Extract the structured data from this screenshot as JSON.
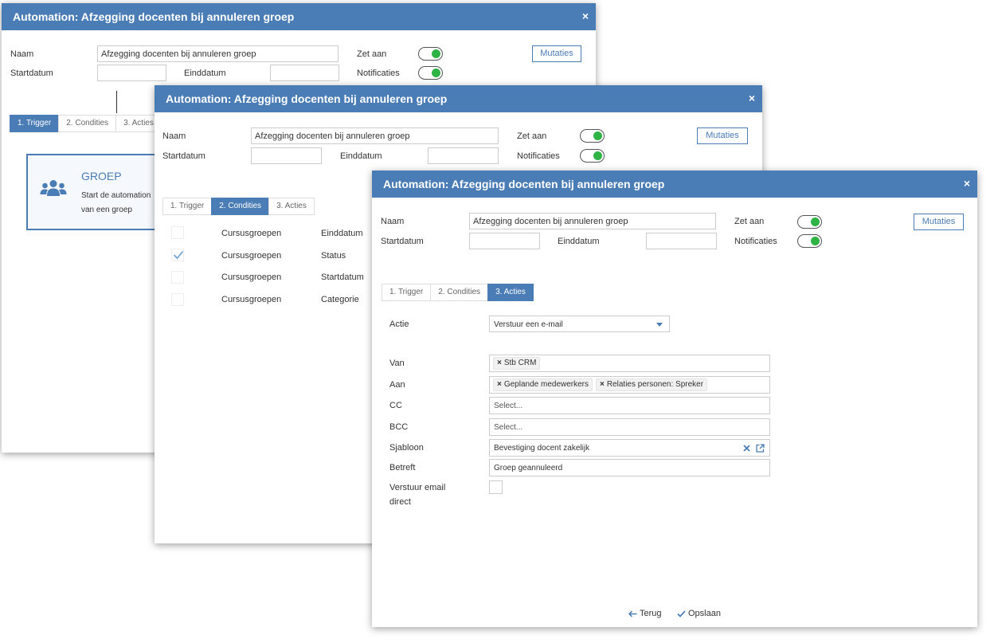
{
  "dialog": {
    "title": "Automation: Afzegging docenten bij annuleren groep",
    "close": "×",
    "naam_label": "Naam",
    "naam_value": "Afzegging docenten bij annuleren groep",
    "startdatum_label": "Startdatum",
    "einddatum_label": "Einddatum",
    "zet_aan_label": "Zet aan",
    "notificaties_label": "Notificaties",
    "mutaties_label": "Mutaties",
    "tabs": [
      "1. Trigger",
      "2. Condities",
      "3. Acties"
    ]
  },
  "trigger": {
    "card_title": "GROEP",
    "card_desc_line1": "Start de automation",
    "card_desc_line2": "van een groep"
  },
  "conditions": [
    {
      "group": "Cursusgroepen",
      "field": "Einddatum",
      "checked": false
    },
    {
      "group": "Cursusgroepen",
      "field": "Status",
      "checked": true
    },
    {
      "group": "Cursusgroepen",
      "field": "Startdatum",
      "checked": false
    },
    {
      "group": "Cursusgroepen",
      "field": "Categorie",
      "checked": false
    }
  ],
  "actions": {
    "actie_label": "Actie",
    "actie_value": "Verstuur een e-mail",
    "van_label": "Van",
    "van_chips": [
      "Stb CRM"
    ],
    "aan_label": "Aan",
    "aan_chips": [
      "Geplande medewerkers",
      "Relaties personen: Spreker"
    ],
    "cc_label": "CC",
    "cc_placeholder": "Select...",
    "bcc_label": "BCC",
    "bcc_placeholder": "Select...",
    "sjabloon_label": "Sjabloon",
    "sjabloon_value": "Bevestiging docent zakelijk",
    "betreft_label": "Betreft",
    "betreft_value": "Groep geannuleerd",
    "verstuur_label_line1": "Verstuur email",
    "verstuur_label_line2": "direct",
    "terug_label": "Terug",
    "opslaan_label": "Opslaan"
  },
  "colors": {
    "header": "#4a7cb5",
    "toggle_on": "#2fb344",
    "tab_active": "#4a7cb5",
    "check": "#6aa0d6"
  }
}
